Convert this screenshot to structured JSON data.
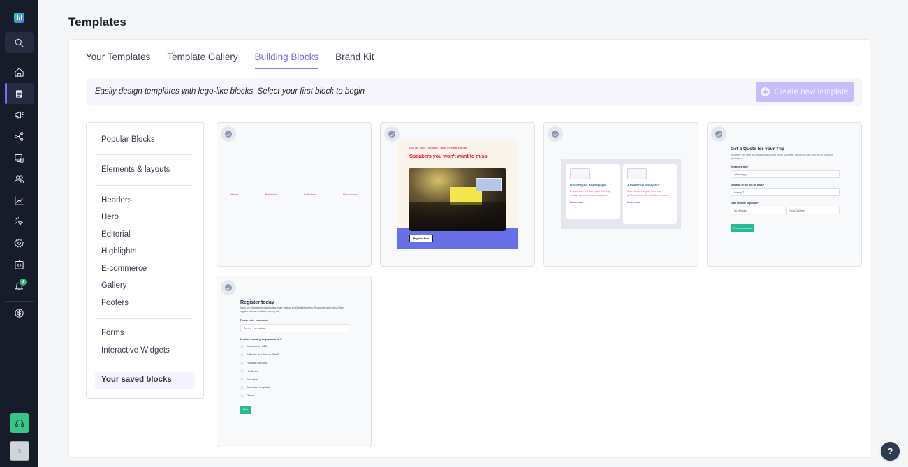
{
  "sidebar": {
    "badge_count": "4",
    "avatar_initial": "S",
    "items": [
      {
        "name": "home",
        "icon": "home-icon"
      },
      {
        "name": "templates",
        "icon": "template-icon",
        "active": true
      },
      {
        "name": "campaigns",
        "icon": "megaphone-icon"
      },
      {
        "name": "journeys",
        "icon": "share-flow-icon"
      },
      {
        "name": "channels",
        "icon": "devices-icon"
      },
      {
        "name": "contacts",
        "icon": "users-icon"
      },
      {
        "name": "analytics",
        "icon": "chart-icon"
      },
      {
        "name": "web-tracking",
        "icon": "cursor-click-icon"
      },
      {
        "name": "settings",
        "icon": "gear-icon"
      },
      {
        "name": "integrations",
        "icon": "code-icon"
      },
      {
        "name": "notifications",
        "icon": "bell-icon"
      },
      {
        "name": "billing",
        "icon": "dollar-icon"
      }
    ]
  },
  "page": {
    "title": "Templates"
  },
  "tabs": [
    {
      "label": "Your Templates"
    },
    {
      "label": "Template Gallery"
    },
    {
      "label": "Building Blocks",
      "active": true
    },
    {
      "label": "Brand Kit"
    }
  ],
  "banner": {
    "text": "Easily design templates with lego-like blocks. Select your first block to begin",
    "create_button": "Create new template"
  },
  "categories": {
    "popular": "Popular Blocks",
    "elements": "Elements & layouts",
    "group1": [
      "Headers",
      "Hero",
      "Editorial",
      "Highlights",
      "E-commerce",
      "Gallery",
      "Footers"
    ],
    "group2": [
      "Forms",
      "Interactive Widgets"
    ],
    "saved": "Your saved blocks"
  },
  "blocks": {
    "header": {
      "links": [
        "Home",
        "Products",
        "Solutions",
        "Resources"
      ]
    },
    "event": {
      "meta": "Oct 16, 2024  •  9:00am - 5pm  •  Virtual events",
      "title": "Speakers you won't want to miss",
      "button": "Register Now"
    },
    "highlights": {
      "cards": [
        {
          "title": "Revamped homepage",
          "desc": "Experience a fresh, user-friendly design for seamless navigation",
          "link": "Learn more"
        },
        {
          "title": "Advanced analytics",
          "desc": "Gain deep insights into your performance with detailed metrics",
          "link": "Learn more"
        }
      ]
    },
    "quote_form": {
      "title": "Get a Quote for your Trip",
      "desc": "Hey there! We have an ongoing special offer for the Bahamas. Fill out this form and you will get your special price.",
      "date_label": "Departure date *",
      "date_placeholder": "dd/mm/yyyy",
      "duration_label": "Duration of the trip (in days)*",
      "duration_placeholder": "For e.g. 7",
      "people_label": "Total number of people*",
      "adults_placeholder": "No of Adults",
      "children_placeholder": "No of Children",
      "button": "Choose services"
    },
    "register_form": {
      "title": "Register today",
      "desc": "If you are interested in participating in our webinar on 'Digital Marketing: The way forward with AI' then register soon as seats are running out!",
      "name_label": "Please enter your name*",
      "name_placeholder": "For e.g. Joe Andrew",
      "industry_label": "In which industry, do you work for?*",
      "options": [
        "Ecommerce / D2C",
        "Software as a Service (SaaS)",
        "Financial Services",
        "Healthcare",
        "Education",
        "Travel and Hospitality",
        "Others"
      ],
      "button": "Next"
    }
  },
  "help": {
    "label": "?"
  },
  "colors": {
    "accent": "#7b68ee",
    "sidebar_bg": "#171c2b",
    "create_button_bg": "#c8bdfa",
    "support_green": "#39c48a",
    "form_button": "#2bb894"
  }
}
